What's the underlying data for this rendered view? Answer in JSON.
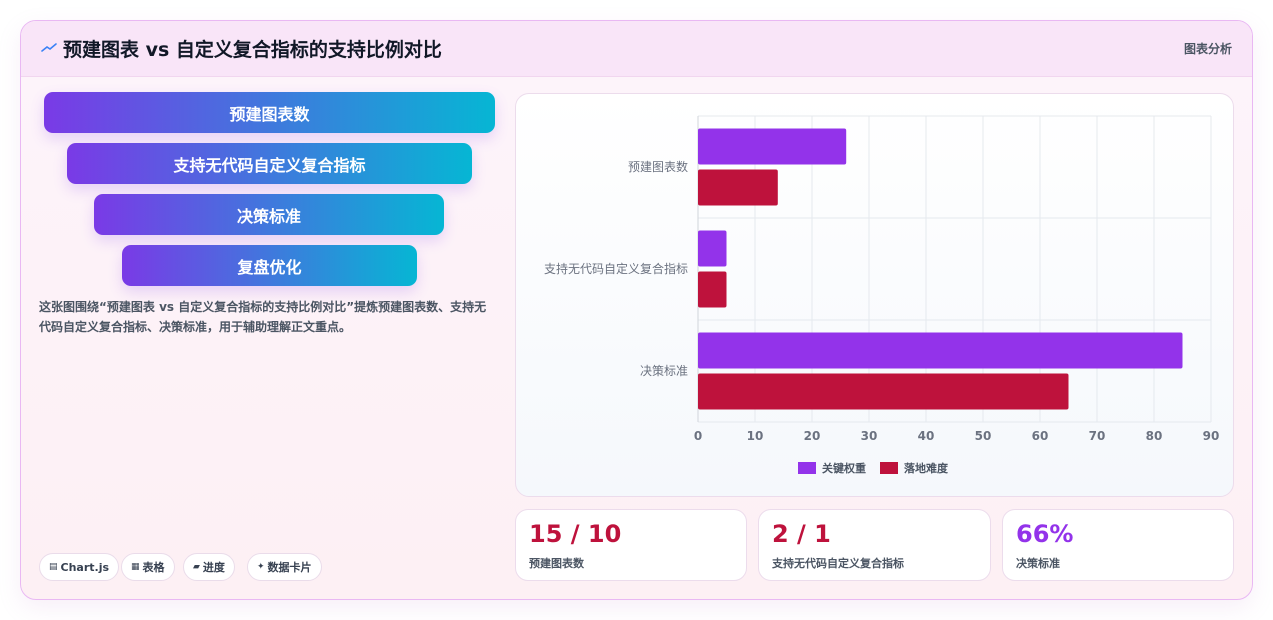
{
  "header": {
    "title": "预建图表 vs 自定义复合指标的支持比例对比",
    "tag": "图表分析"
  },
  "funnel": [
    "预建图表数",
    "支持无代码自定义复合指标",
    "决策标准",
    "复盘优化"
  ],
  "description": "这张图围绕“预建图表 vs 自定义复合指标的支持比例对比”提炼预建图表数、支持无代码自定义复合指标、决策标准，用于辅助理解正文重点。",
  "chips": [
    {
      "icon": "chart-icon",
      "glyph": "▤",
      "label": "Chart.js"
    },
    {
      "icon": "table-icon",
      "glyph": "▦",
      "label": "表格"
    },
    {
      "icon": "progress-icon",
      "glyph": "▰",
      "label": "进度"
    },
    {
      "icon": "sparkle-icon",
      "glyph": "✦",
      "label": "数据卡片"
    }
  ],
  "stats": [
    {
      "value": "15 / 10",
      "label": "预建图表数",
      "color": "#be123c"
    },
    {
      "value": "2 / 1",
      "label": "支持无代码自定义复合指标",
      "color": "#be123c"
    },
    {
      "value": "66%",
      "label": "决策标准",
      "color": "#9333ea"
    }
  ],
  "colors": {
    "series1": "#9333ea",
    "series2": "#be123c"
  },
  "chart_data": {
    "type": "bar",
    "orientation": "horizontal",
    "categories": [
      "预建图表数",
      "支持无代码自定义复合指标",
      "决策标准"
    ],
    "series": [
      {
        "name": "关键权重",
        "values": [
          26,
          5,
          85
        ],
        "color": "#9333ea"
      },
      {
        "name": "落地难度",
        "values": [
          14,
          5,
          65
        ],
        "color": "#be123c"
      }
    ],
    "xlim": [
      0,
      90
    ],
    "xticks": [
      0,
      10,
      20,
      30,
      40,
      50,
      60,
      70,
      80,
      90
    ],
    "grid": true,
    "legend": "bottom"
  }
}
